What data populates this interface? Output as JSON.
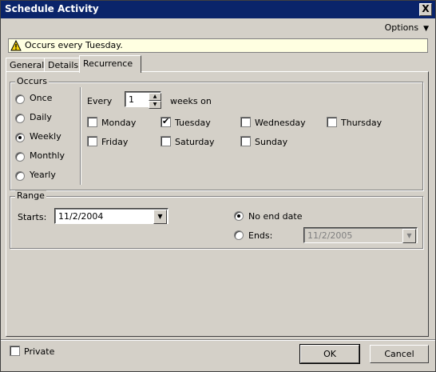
{
  "window": {
    "title": "Schedule Activity",
    "close_glyph": "X"
  },
  "options_label": "Options",
  "warning": {
    "text": "Occurs every Tuesday."
  },
  "tabs": [
    {
      "label": "General",
      "active": false
    },
    {
      "label": "Details",
      "active": false
    },
    {
      "label": "Recurrence",
      "active": true
    }
  ],
  "occurs": {
    "legend": "Occurs",
    "options": [
      "Once",
      "Daily",
      "Weekly",
      "Monthly",
      "Yearly"
    ],
    "selected": "Weekly",
    "every_label": "Every",
    "every_value": "1",
    "weeks_on_label": "weeks on",
    "days": [
      {
        "label": "Monday",
        "checked": false
      },
      {
        "label": "Tuesday",
        "checked": true
      },
      {
        "label": "Wednesday",
        "checked": false
      },
      {
        "label": "Thursday",
        "checked": false
      },
      {
        "label": "Friday",
        "checked": false
      },
      {
        "label": "Saturday",
        "checked": false
      },
      {
        "label": "Sunday",
        "checked": false
      }
    ]
  },
  "range": {
    "legend": "Range",
    "starts_label": "Starts:",
    "starts_value": "11/2/2004",
    "no_end_label": "No end date",
    "ends_label": "Ends:",
    "ends_value": "11/2/2005",
    "selected": "No end date"
  },
  "footer": {
    "private_label": "Private",
    "private_checked": false,
    "ok_label": "OK",
    "cancel_label": "Cancel"
  },
  "colors": {
    "titlebar": "#0a246a",
    "face": "#d4d0c8",
    "info_bg": "#ffffe1"
  }
}
